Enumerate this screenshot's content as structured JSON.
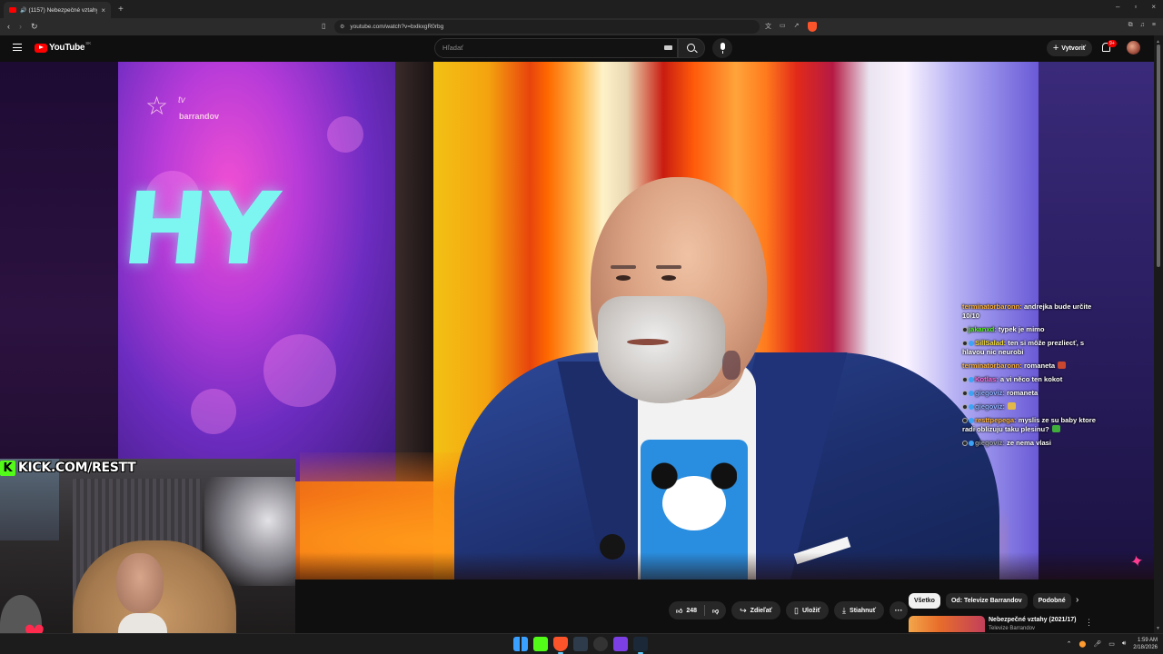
{
  "browser": {
    "tab_title": "(1157) Nebezpečné vztahy (2",
    "tab_close": "×",
    "new_tab": "+",
    "url": "youtube.com/watch?v=bxlkxgR0rbg",
    "window_controls": [
      "–",
      "▫",
      "×"
    ]
  },
  "youtube": {
    "logo_text": "YouTube",
    "country_code": "SK",
    "search_placeholder": "Hľadať",
    "create_label": "Vytvoriť",
    "notifications_badge": "9+"
  },
  "video": {
    "channel_logo_line1": "tv",
    "channel_logo_line2": "barrandov",
    "screen_text": "HY",
    "kick_banner": "KICK.COM/RESTT",
    "chat": [
      {
        "user": "terminatorbaronn:",
        "text": " andrejka bude určite 10/10",
        "color": "u-or",
        "icons": 0
      },
      {
        "user": "jakanxd:",
        "text": " typek je mimo",
        "color": "u-gr",
        "icons": 1
      },
      {
        "user": "SillSalad:",
        "text": " ten si môže prezliecť, s hlavou nic neurobi",
        "color": "u-ye",
        "icons": 2
      },
      {
        "user": "terminatorbaronn:",
        "text": " romaneta",
        "color": "u-or",
        "icons": 0
      },
      {
        "user": "Kotlas:",
        "text": " a vi něco ten kokot",
        "color": "u-mg",
        "icons": 2
      },
      {
        "user": "giegoviz:",
        "text": " romaneta",
        "color": "u-bl",
        "icons": 2
      },
      {
        "user": "giegoviz:",
        "text": "",
        "color": "u-bl",
        "icons": 2
      },
      {
        "user": "resttpepega:",
        "text": " myslis ze su baby ktore radi oblizuju taku plesinu?",
        "color": "u-or",
        "icons": 2
      },
      {
        "user": "giegoviz:",
        "text": " ze nema vlasi",
        "color": "u-gy",
        "icons": 2
      }
    ]
  },
  "actions": {
    "like_count": "248",
    "share_label": "Zdieľať",
    "save_label": "Uložiť",
    "download_label": "Stiahnuť",
    "more_label": "···"
  },
  "chips": [
    "Všetko",
    "Od: Televize Barrandov",
    "Podobné"
  ],
  "recommendation": {
    "title": "Nebezpečné vztahy (2021/17)",
    "subtitle": "Televize Barrandov"
  },
  "taskbar": {
    "time": "1:59 AM",
    "date": "2/18/2026"
  }
}
